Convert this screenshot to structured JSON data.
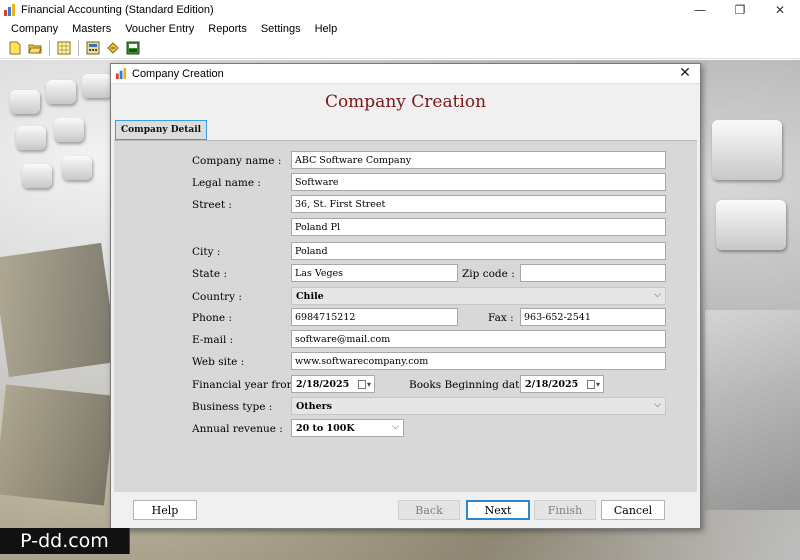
{
  "app": {
    "title": "Financial Accounting (Standard Edition)",
    "controls": {
      "minimize": "—",
      "restore": "❐",
      "close": "✕"
    }
  },
  "menu": [
    "Company",
    "Masters",
    "Voucher Entry",
    "Reports",
    "Settings",
    "Help"
  ],
  "toolbar_icons": [
    "new-file-icon",
    "open-folder-icon",
    "grid-icon",
    "calculator-icon",
    "edit-icon",
    "printer-icon"
  ],
  "dialog": {
    "title": "Company Creation",
    "heading": "Company Creation",
    "close": "✕",
    "tab": "Company Detail",
    "heading_color": "#7a1616",
    "labels": {
      "company_name": "Company name :",
      "legal_name": "Legal name :",
      "street": "Street :",
      "city": "City :",
      "state": "State :",
      "zip": "Zip code :",
      "country": "Country :",
      "phone": "Phone :",
      "fax": "Fax :",
      "email": "E-mail :",
      "website": "Web site :",
      "fin_year": "Financial year from :",
      "books_date": "Books Beginning date:",
      "business_type": "Business type :",
      "annual_revenue": "Annual revenue :"
    },
    "values": {
      "company_name": "ABC Software Company",
      "legal_name": "Software",
      "street1": "36, St. First Street",
      "street2": "Poland Pl",
      "city": "Poland",
      "state": "Las Veges",
      "zip": "",
      "country": "Chile",
      "phone": "6984715212",
      "fax": "963-652-2541",
      "email": "software@mail.com",
      "website": "www.softwarecompany.com",
      "fin_year": "2/18/2025",
      "books_date": "2/18/2025",
      "business_type": "Others",
      "annual_revenue": "20 to 100K"
    },
    "buttons": {
      "help": "Help",
      "back": "Back",
      "next": "Next",
      "finish": "Finish",
      "cancel": "Cancel"
    }
  },
  "watermark": "P-dd.com"
}
